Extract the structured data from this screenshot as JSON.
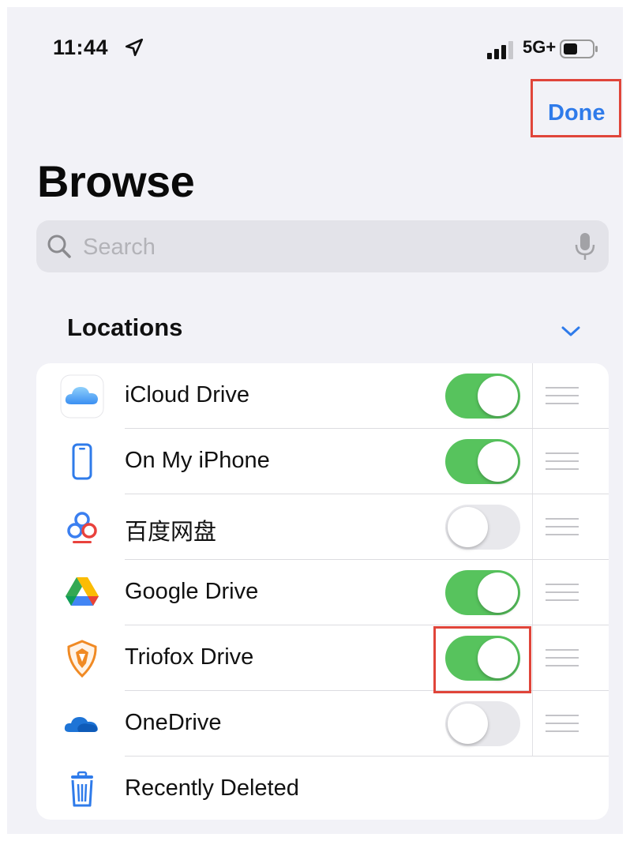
{
  "status_bar": {
    "time": "11:44",
    "network": "5G+"
  },
  "header": {
    "done_label": "Done",
    "title": "Browse"
  },
  "search": {
    "placeholder": "Search",
    "value": ""
  },
  "locations": {
    "header": "Locations",
    "items": [
      {
        "label": "iCloud Drive",
        "icon": "icloud-icon",
        "enabled": true
      },
      {
        "label": "On My iPhone",
        "icon": "iphone-icon",
        "enabled": true
      },
      {
        "label": "百度网盘",
        "icon": "baidu-netdisk-icon",
        "enabled": false
      },
      {
        "label": "Google Drive",
        "icon": "google-drive-icon",
        "enabled": true
      },
      {
        "label": "Triofox Drive",
        "icon": "triofox-icon",
        "enabled": true
      },
      {
        "label": "OneDrive",
        "icon": "onedrive-icon",
        "enabled": false
      },
      {
        "label": "Recently Deleted",
        "icon": "trash-icon"
      }
    ]
  },
  "colors": {
    "accent": "#2f7bea",
    "toggle_on": "#57c35d",
    "highlight": "#e0453a"
  }
}
